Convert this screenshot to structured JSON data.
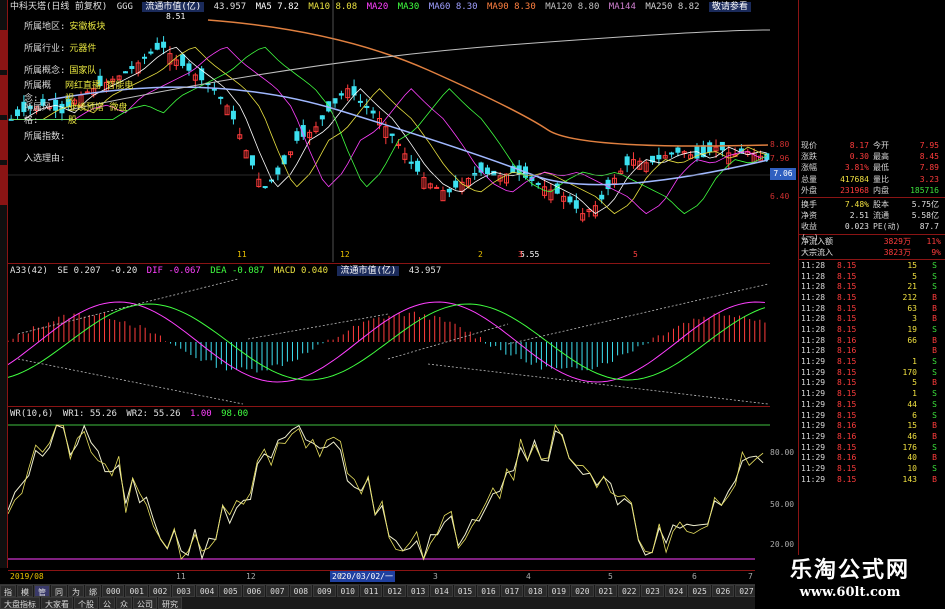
{
  "main_header": {
    "stock_title": "中科天塔(日线 前复权)",
    "ggg": "GGG",
    "indicator": "流通市值(亿)",
    "indicator_value": "43.957",
    "ma5": "MA5 7.82",
    "ma10": "MA10 8.08",
    "ma20": "MA20",
    "ma30": "MA30",
    "ma60": "MA60 8.30",
    "ma90": "MA90 8.30",
    "ma120": "MA120 8.80",
    "ma144": "MA144",
    "ma250": "MA250 8.82",
    "extra": "敬请参看"
  },
  "f10_panel": [
    {
      "key": "所属地区:",
      "value": "安徽板块"
    },
    {
      "key": "所属行业:",
      "value": "元器件"
    },
    {
      "key": "所属概念:",
      "value": "国家队"
    },
    {
      "key": "所属概念:",
      "value": "网红直播 智能电视"
    },
    {
      "key": "所属风格:",
      "value": "业绩预增 微盘股"
    },
    {
      "key": "所属指数:",
      "value": ""
    },
    {
      "key": "入选理由:",
      "value": ""
    }
  ],
  "main_annotations": {
    "high_price": "8.51",
    "low_price": "5.55"
  },
  "date_markers": [
    "11",
    "12",
    "2",
    "3",
    "5"
  ],
  "price_axis": [
    "8.80",
    "7.96",
    "7.06",
    "6.40"
  ],
  "macd_header": {
    "name": "A33(42)",
    "se": "SE 0.207",
    "v2": "-0.20",
    "dif": "DIF -0.067",
    "dea": "DEA -0.087",
    "macd": "MACD 0.040",
    "circ": "流通市值(亿)",
    "circ_value": "43.957"
  },
  "wr_header": {
    "name": "WR(10,6)",
    "wr1": "WR1: 55.26",
    "wr2": "WR2: 55.26",
    "v1": "1.00",
    "v2": "98.00"
  },
  "wr_axis": [
    "80.00",
    "50.00",
    "20.00"
  ],
  "quote": {
    "rows": [
      {
        "k1": "现价",
        "v1": "8.17",
        "k2": "今开",
        "v2": "7.95",
        "c1": "red",
        "c2": "red"
      },
      {
        "k1": "涨跌",
        "v1": "0.30",
        "k2": "最高",
        "v2": "8.45",
        "c1": "red",
        "c2": "red"
      },
      {
        "k1": "涨幅",
        "v1": "3.81%",
        "k2": "最低",
        "v2": "7.89",
        "c1": "red",
        "c2": "red"
      },
      {
        "k1": "总量",
        "v1": "417684",
        "k2": "量比",
        "v2": "3.23",
        "c1": "yellow",
        "c2": "red"
      },
      {
        "k1": "外盘",
        "v1": "231968",
        "k2": "内盘",
        "v2": "185716",
        "c1": "red",
        "c2": "green"
      }
    ],
    "rows2": [
      {
        "k1": "换手",
        "v1": "7.48%",
        "k2": "股本",
        "v2": "5.75亿",
        "c1": "yellow",
        "c2": "white"
      },
      {
        "k1": "净资",
        "v1": "2.51",
        "k2": "流通",
        "v2": "5.58亿",
        "c1": "white",
        "c2": "white"
      },
      {
        "k1": "收益(一)",
        "v1": "0.023",
        "k2": "PE(动)",
        "v2": "87.7",
        "c1": "white",
        "c2": "white"
      }
    ],
    "flows": [
      {
        "k": "净流入额",
        "v": "3829万",
        "p": "11%"
      },
      {
        "k": "大宗流入",
        "v": "3823万",
        "p": "9%"
      }
    ],
    "ticks": [
      {
        "t": "11:28",
        "p": "8.15",
        "v": "15",
        "s": "S"
      },
      {
        "t": "11:28",
        "p": "8.15",
        "v": "5",
        "s": "S"
      },
      {
        "t": "11:28",
        "p": "8.15",
        "v": "21",
        "s": "S"
      },
      {
        "t": "11:28",
        "p": "8.15",
        "v": "212",
        "s": "B"
      },
      {
        "t": "11:28",
        "p": "8.15",
        "v": "63",
        "s": "B"
      },
      {
        "t": "11:28",
        "p": "8.15",
        "v": "3",
        "s": "B"
      },
      {
        "t": "11:28",
        "p": "8.15",
        "v": "19",
        "s": "S"
      },
      {
        "t": "11:28",
        "p": "8.16",
        "v": "66",
        "s": "B"
      },
      {
        "t": "11:28",
        "p": "8.16",
        "v": "",
        "s": "B"
      },
      {
        "t": "11:29",
        "p": "8.15",
        "v": "1",
        "s": "S"
      },
      {
        "t": "11:29",
        "p": "8.15",
        "v": "170",
        "s": "S"
      },
      {
        "t": "11:29",
        "p": "8.15",
        "v": "5",
        "s": "B"
      },
      {
        "t": "11:29",
        "p": "8.15",
        "v": "1",
        "s": "S"
      },
      {
        "t": "11:29",
        "p": "8.15",
        "v": "44",
        "s": "S"
      },
      {
        "t": "11:29",
        "p": "8.15",
        "v": "6",
        "s": "S"
      },
      {
        "t": "11:29",
        "p": "8.16",
        "v": "15",
        "s": "B"
      },
      {
        "t": "11:29",
        "p": "8.16",
        "v": "46",
        "s": "B"
      },
      {
        "t": "11:29",
        "p": "8.15",
        "v": "176",
        "s": "S"
      },
      {
        "t": "11:29",
        "p": "8.16",
        "v": "40",
        "s": "B"
      },
      {
        "t": "11:29",
        "p": "8.15",
        "v": "10",
        "s": "S"
      },
      {
        "t": "11:29",
        "p": "8.15",
        "v": "143",
        "s": "B"
      }
    ]
  },
  "time_axis": {
    "start": "2019/08",
    "cursor": "2020/03/02/一",
    "months": [
      "11",
      "12",
      "2",
      "3",
      "4",
      "5",
      "6",
      "7"
    ]
  },
  "tabs_row1": [
    "指标",
    "模板",
    "管理",
    "同行",
    "为",
    "绑定股",
    "000",
    "001",
    "002",
    "003",
    "004",
    "005",
    "006",
    "007",
    "008",
    "009",
    "010",
    "011",
    "012",
    "013",
    "014",
    "015",
    "016",
    "017",
    "018",
    "019",
    "020",
    "021",
    "022",
    "023",
    "024",
    "025",
    "026",
    "027",
    "028",
    "029",
    "030",
    "031",
    "032",
    "033",
    "034",
    "035",
    "036",
    "037",
    "038",
    "039",
    "040",
    "041",
    "042",
    "043"
  ],
  "tabs_row2": [
    "大盘指标",
    "大家看",
    "个股",
    "公",
    "众",
    "公司",
    "研究"
  ],
  "watermark": {
    "title": "乐淘公式网",
    "url": "www.60lt.com"
  },
  "current_price_tag": "7.06",
  "colors": {
    "up": "#ff3c3c",
    "down": "#3ce0f0",
    "border": "#8a1414"
  }
}
